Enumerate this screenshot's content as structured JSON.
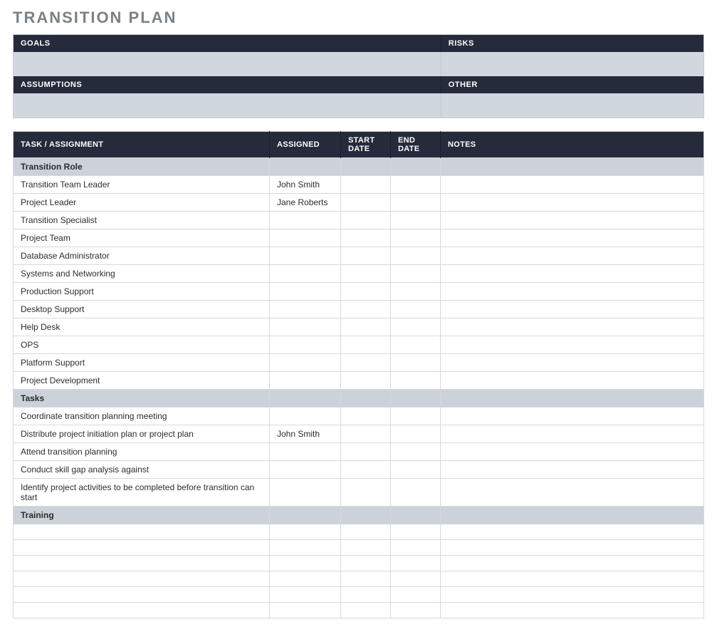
{
  "title": "TRANSITION PLAN",
  "summary": {
    "goals_label": "GOALS",
    "risks_label": "RISKS",
    "assumptions_label": "ASSUMPTIONS",
    "other_label": "OTHER",
    "goals_value": "",
    "risks_value": "",
    "assumptions_value": "",
    "other_value": ""
  },
  "columns": {
    "task": "TASK / ASSIGNMENT",
    "assigned": "ASSIGNED",
    "start": "START DATE",
    "end": "END DATE",
    "notes": "NOTES"
  },
  "sections": [
    {
      "name": "Transition Role",
      "rows": [
        {
          "task": "Transition Team Leader",
          "assigned": "John Smith",
          "start": "",
          "end": "",
          "notes": ""
        },
        {
          "task": "Project Leader",
          "assigned": "Jane Roberts",
          "start": "",
          "end": "",
          "notes": ""
        },
        {
          "task": "Transition Specialist",
          "assigned": "",
          "start": "",
          "end": "",
          "notes": ""
        },
        {
          "task": "Project Team",
          "assigned": "",
          "start": "",
          "end": "",
          "notes": ""
        },
        {
          "task": "Database Administrator",
          "assigned": "",
          "start": "",
          "end": "",
          "notes": ""
        },
        {
          "task": "Systems and Networking",
          "assigned": "",
          "start": "",
          "end": "",
          "notes": ""
        },
        {
          "task": "Production Support",
          "assigned": "",
          "start": "",
          "end": "",
          "notes": ""
        },
        {
          "task": "Desktop Support",
          "assigned": "",
          "start": "",
          "end": "",
          "notes": ""
        },
        {
          "task": "Help Desk",
          "assigned": "",
          "start": "",
          "end": "",
          "notes": ""
        },
        {
          "task": "OPS",
          "assigned": "",
          "start": "",
          "end": "",
          "notes": ""
        },
        {
          "task": "Platform Support",
          "assigned": "",
          "start": "",
          "end": "",
          "notes": ""
        },
        {
          "task": "Project Development",
          "assigned": "",
          "start": "",
          "end": "",
          "notes": ""
        }
      ]
    },
    {
      "name": "Tasks",
      "rows": [
        {
          "task": "Coordinate transition planning meeting",
          "assigned": "",
          "start": "",
          "end": "",
          "notes": ""
        },
        {
          "task": "Distribute project initiation plan or project plan",
          "assigned": "John Smith",
          "start": "",
          "end": "",
          "notes": ""
        },
        {
          "task": "Attend transition planning",
          "assigned": "",
          "start": "",
          "end": "",
          "notes": ""
        },
        {
          "task": "Conduct skill gap analysis against",
          "assigned": "",
          "start": "",
          "end": "",
          "notes": ""
        },
        {
          "task": "Identify project activities to be completed before transition can start",
          "assigned": "",
          "start": "",
          "end": "",
          "notes": ""
        }
      ]
    },
    {
      "name": "Training",
      "rows": [
        {
          "task": "",
          "assigned": "",
          "start": "",
          "end": "",
          "notes": ""
        },
        {
          "task": "",
          "assigned": "",
          "start": "",
          "end": "",
          "notes": ""
        },
        {
          "task": "",
          "assigned": "",
          "start": "",
          "end": "",
          "notes": ""
        },
        {
          "task": "",
          "assigned": "",
          "start": "",
          "end": "",
          "notes": ""
        },
        {
          "task": "",
          "assigned": "",
          "start": "",
          "end": "",
          "notes": ""
        },
        {
          "task": "",
          "assigned": "",
          "start": "",
          "end": "",
          "notes": ""
        }
      ]
    }
  ]
}
